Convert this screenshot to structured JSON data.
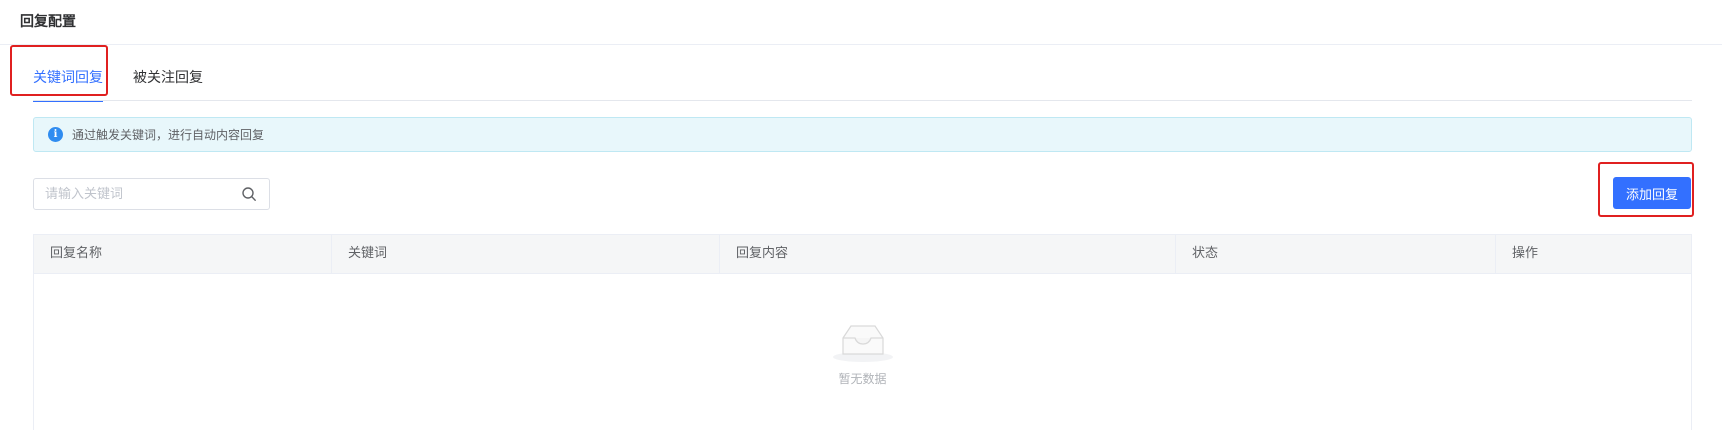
{
  "page": {
    "title": "回复配置"
  },
  "tabs": [
    {
      "label": "关键词回复",
      "active": true
    },
    {
      "label": "被关注回复",
      "active": false
    }
  ],
  "alert": {
    "icon": "info-icon",
    "text": "通过触发关键词，进行自动内容回复"
  },
  "search": {
    "placeholder": "请输入关键词",
    "value": "",
    "icon": "search-icon"
  },
  "actions": {
    "add_label": "添加回复"
  },
  "table": {
    "columns": [
      "回复名称",
      "关键词",
      "回复内容",
      "状态",
      "操作"
    ],
    "rows": [],
    "empty_text": "暂无数据"
  },
  "colors": {
    "accent": "#3370ff",
    "highlight": "#e02020",
    "alert_bg": "#e8f7fb",
    "info": "#2f8cf0"
  }
}
